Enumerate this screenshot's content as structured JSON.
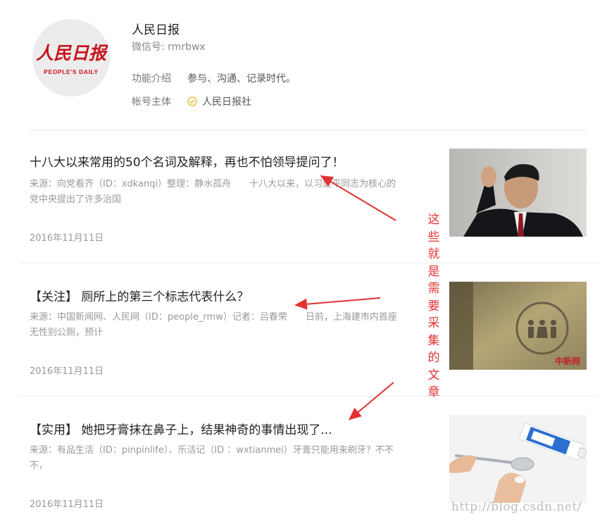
{
  "account": {
    "name": "人民日报",
    "wechat_id": "微信号: rmrbwx",
    "logo_text_cn": "人民日报",
    "logo_text_en": "PEOPLE'S DAILY",
    "intro_label": "功能介绍",
    "intro_value": "参与、沟通、记录时代。",
    "owner_label": "帐号主体",
    "owner_value": "人民日报社",
    "verified_icon": "verified-check-icon"
  },
  "articles": [
    {
      "title": "十八大以来常用的50个名词及解释，再也不怕领导提问了！",
      "summary_line1": "来源：向党看齐（ID：xdkanqi）整理：静水孤舟　　十八大以来，以习近平同志为核心的",
      "summary_line2": "党中央提出了许多治国",
      "date": "2016年11月11日"
    },
    {
      "title": "【关注】 厕所上的第三个标志代表什么？",
      "summary_line1": "来源：中国新闻网、人民网（ID：people_rmw）记者：吕春荣　　日前，上海建市内首座",
      "summary_line2": "无性别公厕，预计",
      "date": "2016年11月11日",
      "thumb_watermark": "中新网"
    },
    {
      "title": "【实用】 她把牙膏抹在鼻子上，结果神奇的事情出现了...",
      "summary_line1": "来源：有品生活（ID：pinpinlife）、乐活记（ID ：wxtianmei）牙膏只能用来刷牙？不不",
      "summary_line2": "不，",
      "date": "2016年11月11日"
    }
  ],
  "annotation": {
    "chars": [
      "这",
      "些",
      "就",
      "是",
      "需",
      "要",
      "采",
      "集",
      "的",
      "文",
      "章"
    ],
    "color": "#e23232"
  },
  "watermark": "http://blog.csdn.net/"
}
